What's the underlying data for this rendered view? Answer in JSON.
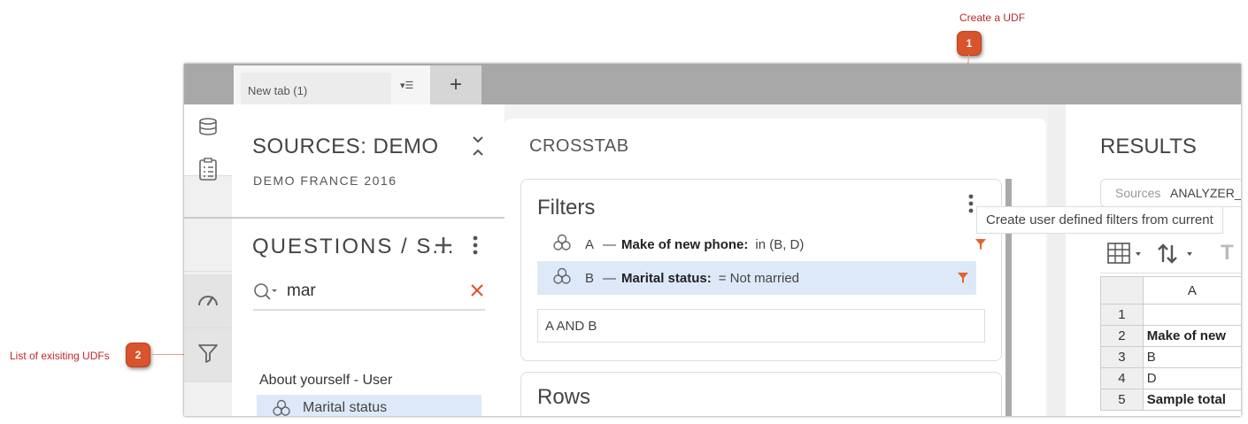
{
  "annotations": {
    "udf_create_label": "Create a UDF",
    "udf_create_number": "1",
    "udf_list_label": "List of exisiting UDFs",
    "udf_list_number": "2"
  },
  "tabs": {
    "items": [
      {
        "label": "New tab (1)"
      }
    ],
    "add_label": "+",
    "menu_glyph": "▾☰"
  },
  "sources": {
    "title": "SOURCES: DEMO",
    "subtitle": "DEMO FRANCE 2016"
  },
  "questions": {
    "title": "QUESTIONS / S...",
    "search_value": "mar",
    "group_label": "About yourself - User",
    "item_label": "Marital status"
  },
  "crosstab": {
    "title": "CROSSTAB",
    "filters": {
      "title": "Filters",
      "rows": [
        {
          "letter": "A",
          "dash": "—",
          "name": "Make of new phone:",
          "condition": "in (B, D)"
        },
        {
          "letter": "B",
          "dash": "—",
          "name": "Marital status:",
          "condition": "= Not married"
        }
      ],
      "expression": "A AND B"
    },
    "rows_title": "Rows"
  },
  "tooltip": "Create user defined filters from current",
  "results": {
    "title": "RESULTS",
    "sources_label": "Sources",
    "sources_value": "ANALYZER_",
    "column_header": "A",
    "rows": [
      {
        "n": "1",
        "value": ""
      },
      {
        "n": "2",
        "value": "Make of new"
      },
      {
        "n": "3",
        "value": "B"
      },
      {
        "n": "4",
        "value": "D"
      },
      {
        "n": "5",
        "value": "Sample total"
      }
    ]
  },
  "colors": {
    "accent": "#d9532c",
    "annotation_text": "#c0262b",
    "selection": "#dde9f8",
    "filter_icon": "#e0642c"
  }
}
